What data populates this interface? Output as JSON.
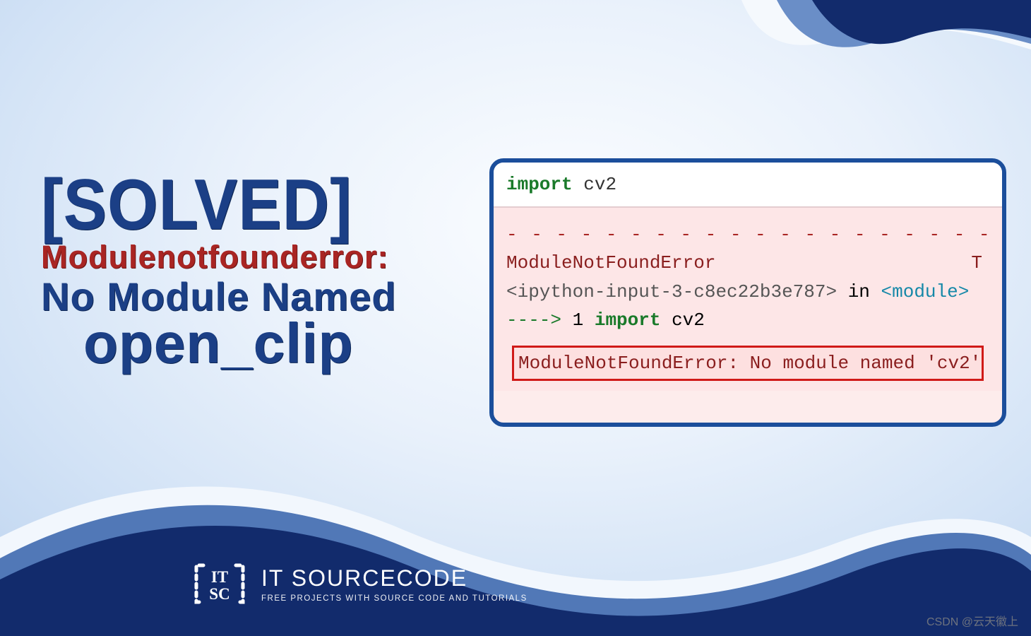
{
  "headline": {
    "solved": "[SOLVED]",
    "error_label": "Modulenotfounderror:",
    "no_module": "No Module Named",
    "target": "open_clip"
  },
  "panel": {
    "import_kw": "import",
    "import_mod": "cv2",
    "dashes": "- - - - - - - - - - - - - - - - - - - - - - - - - - - - - - - - - - - - - - -",
    "err_type": "ModuleNotFoundError",
    "trailing_letter": "T",
    "ipy_prefix": "<ipython-input-3-c8ec22b3e787>",
    "in_word": "in",
    "module_tag": "<module>",
    "arrow": "---->",
    "line_no": "1",
    "import_line_kw": "import",
    "import_line_mod": "cv2",
    "final_error": "ModuleNotFoundError: No module named 'cv2'"
  },
  "footer": {
    "brand": "IT SOURCECODE",
    "tagline": "FREE PROJECTS WITH SOURCE CODE AND TUTORIALS"
  },
  "watermark": "CSDN @云天徽上",
  "colors": {
    "deep_blue": "#122b6c",
    "mid_blue": "#1b4e9b",
    "light_blue": "#5178b7",
    "accent_red": "#a92523"
  }
}
